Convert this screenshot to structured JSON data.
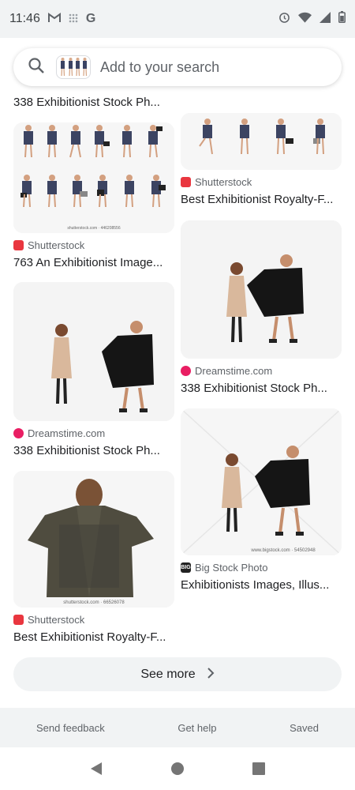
{
  "status_bar": {
    "time": "11:46",
    "left_icons": [
      "gmail-icon",
      "grid-dots-icon",
      "google-g-icon"
    ],
    "right_icons": [
      "alarm-icon",
      "wifi-icon",
      "signal-icon",
      "battery-icon"
    ]
  },
  "search": {
    "placeholder": "Add to your search"
  },
  "cutoff_title": "338 Exhibitionist Stock Ph...",
  "results": [
    {
      "source": "Shutterstock",
      "title": "763 An Exhibitionist Image...",
      "source_color": "#e9363f",
      "caption": "shutterstock.com · 446208556"
    },
    {
      "source": "Shutterstock",
      "title": "Best Exhibitionist Royalty-F...",
      "source_color": "#e9363f"
    },
    {
      "source": "Dreamstime.com",
      "title": "338 Exhibitionist Stock Ph...",
      "source_color": "#e91e63"
    },
    {
      "source": "Dreamstime.com",
      "title": "338 Exhibitionist Stock Ph...",
      "source_color": "#e91e63"
    },
    {
      "source": "Shutterstock",
      "title": "Best Exhibitionist Royalty-F...",
      "source_color": "#e9363f",
      "caption": "shutterstock.com · 66526078"
    },
    {
      "source": "Big Stock Photo",
      "title": "Exhibitionists Images, Illus...",
      "source_color": "#222222",
      "caption": "www.bigstock.com · 54502948"
    }
  ],
  "see_more": {
    "label": "See more"
  },
  "footer": {
    "send_feedback": "Send feedback",
    "get_help": "Get help",
    "saved": "Saved"
  }
}
